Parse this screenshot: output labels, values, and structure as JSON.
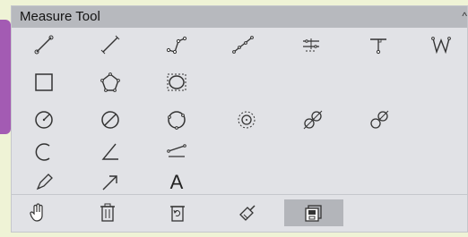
{
  "panel": {
    "title": "Measure Tool",
    "collapse_glyph": "^"
  },
  "tools": [
    {
      "name": "point-to-point-icon"
    },
    {
      "name": "line-icon"
    },
    {
      "name": "polyline-icon"
    },
    {
      "name": "multi-point-line-icon"
    },
    {
      "name": "parallel-lines-icon"
    },
    {
      "name": "perpendicular-icon"
    },
    {
      "name": "zigzag-icon"
    },
    {
      "name": "rectangle-icon"
    },
    {
      "name": "polygon-icon"
    },
    {
      "name": "ellipse-icon"
    },
    {
      "name": "circle-diameter-icon"
    },
    {
      "name": "circle-slash-icon"
    },
    {
      "name": "circle-three-point-icon"
    },
    {
      "name": "concentric-circle-icon"
    },
    {
      "name": "circle-tangent-icon"
    },
    {
      "name": "circle-tangent-alt-icon"
    },
    {
      "name": "arc-icon"
    },
    {
      "name": "angle-icon"
    },
    {
      "name": "two-lines-angle-icon"
    },
    {
      "name": "pencil-icon"
    },
    {
      "name": "arrow-icon"
    },
    {
      "name": "text-tool-icon",
      "label": "A"
    }
  ],
  "bottom_tools": [
    {
      "name": "hand-icon"
    },
    {
      "name": "trash-icon"
    },
    {
      "name": "undo-delete-icon"
    },
    {
      "name": "brush-eraser-icon"
    },
    {
      "name": "save-photo-icon",
      "active": true
    }
  ]
}
